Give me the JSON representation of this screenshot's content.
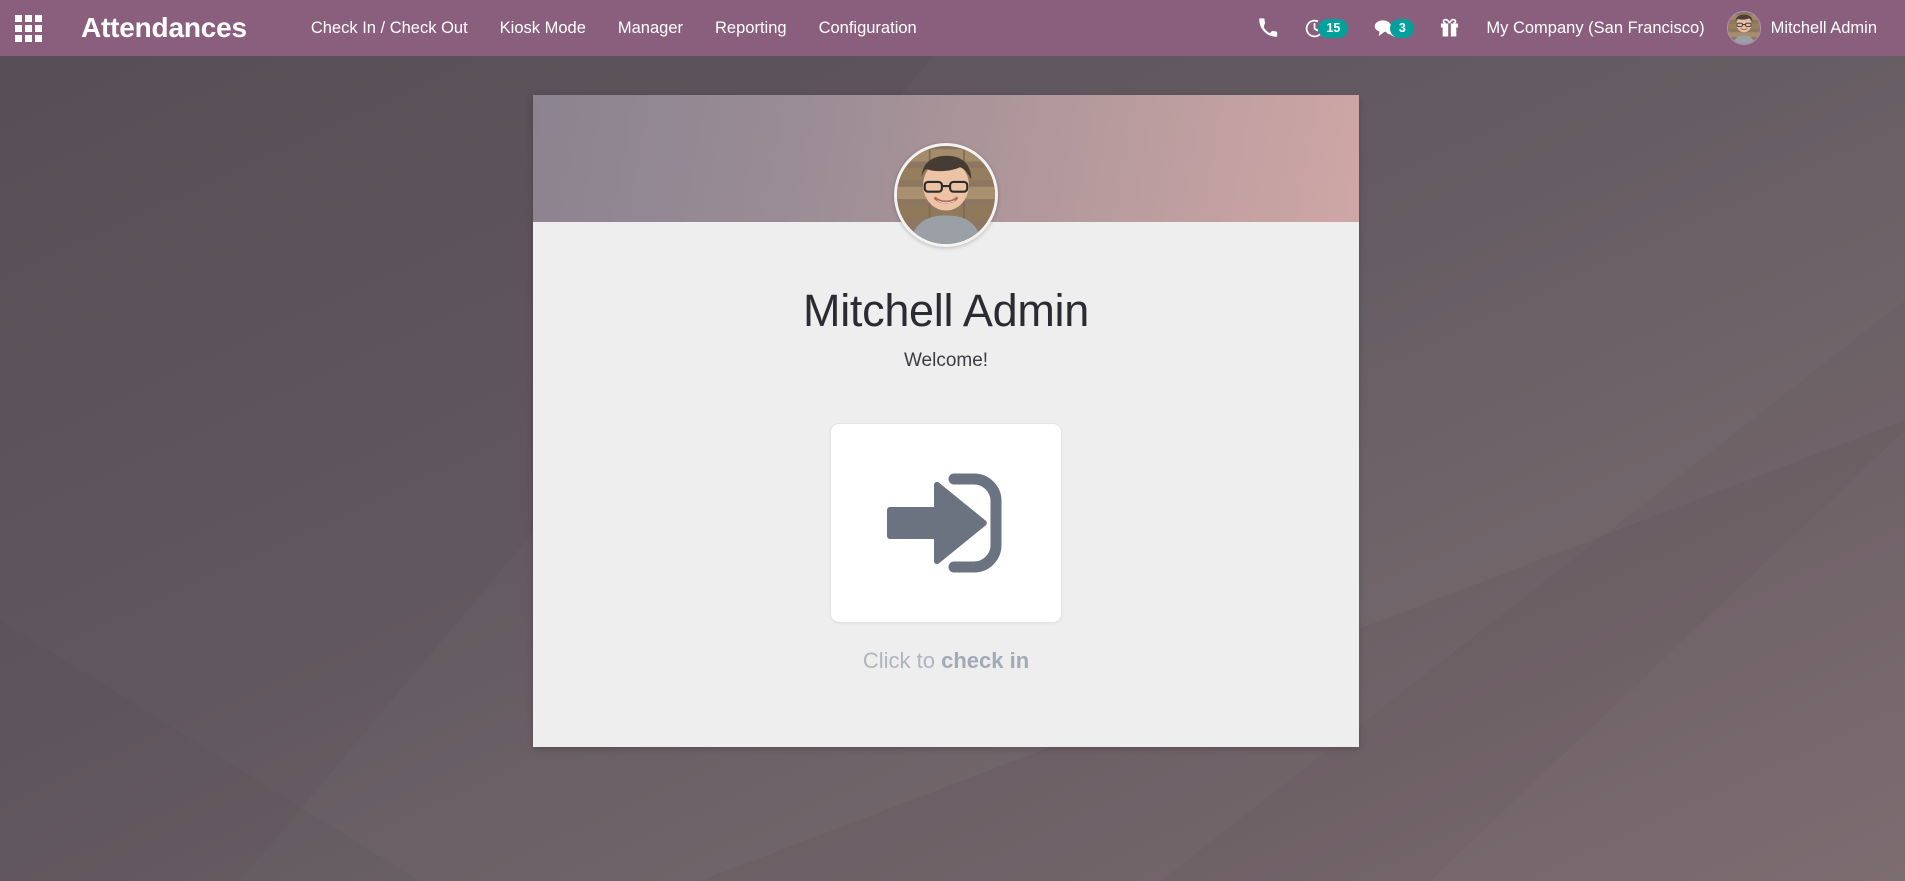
{
  "navbar": {
    "apps_menu_icon": "apps-grid-icon",
    "brand_title": "Attendances",
    "menu_items": [
      {
        "label": "Check In / Check Out",
        "name": "menu-check-in-check-out"
      },
      {
        "label": "Kiosk Mode",
        "name": "menu-kiosk-mode"
      },
      {
        "label": "Manager",
        "name": "menu-manager"
      },
      {
        "label": "Reporting",
        "name": "menu-reporting"
      },
      {
        "label": "Configuration",
        "name": "menu-configuration"
      }
    ],
    "systray": {
      "phone_icon": "phone-icon",
      "activities_icon": "clock-activities-icon",
      "activities_count": "15",
      "messages_icon": "chat-bubble-icon",
      "messages_count": "3",
      "gift_icon": "gift-icon"
    },
    "company": "My Company (San Francisco)",
    "user": {
      "name": "Mitchell Admin",
      "avatar_icon": "user-avatar-photo"
    }
  },
  "card": {
    "avatar_icon": "employee-avatar-photo",
    "employee_name": "Mitchell Admin",
    "welcome_message": "Welcome!",
    "check_in_icon": "sign-in-arrow-icon",
    "caption_prefix": "Click to ",
    "caption_action": "check in"
  },
  "colors": {
    "navbar_bg": "#8a5f7e",
    "desktop_bg": "#5c5159",
    "badge": "#00a09d",
    "card_bg": "#efeeee",
    "caption": "#aeb4c0",
    "icon_gray": "#6b7280"
  }
}
